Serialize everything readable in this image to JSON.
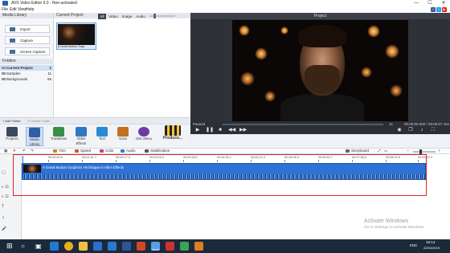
{
  "window": {
    "title": "AVS Video Editor 9.0 - Non-activated",
    "minimize": "—",
    "maximize": "☐",
    "close": "✕"
  },
  "menu": [
    "File",
    "Edit",
    "View",
    "Help"
  ],
  "social": [
    {
      "name": "facebook-icon",
      "color": "#3b5998",
      "glyph": "f"
    },
    {
      "name": "twitter-icon",
      "color": "#1da1f2",
      "glyph": "t"
    },
    {
      "name": "youtube-icon",
      "color": "#e62117",
      "glyph": "▶"
    }
  ],
  "media_library": {
    "header": "Media Library",
    "buttons": [
      {
        "label": "Import",
        "icon": "import-icon"
      },
      {
        "label": "Capture",
        "icon": "capture-icon"
      },
      {
        "label": "Screen Capture",
        "icon": "screen-capture-icon"
      }
    ],
    "folders_header": "Folders",
    "folders": [
      {
        "label": "Current Project",
        "count": "1"
      },
      {
        "label": "Samples",
        "count": "11"
      },
      {
        "label": "Backgrounds",
        "count": "65"
      }
    ],
    "add_folder": "+ Add Folder",
    "delete_folder": "✕ Delete Folder"
  },
  "current_project": {
    "header": "Current Project",
    "filters": [
      "All",
      "Video",
      "Image",
      "Audio"
    ],
    "item_caption": "A Great Motion Grap..."
  },
  "project_panel": {
    "header": "Project",
    "status": "Paused",
    "zoom": "1x",
    "time": "00:00:00.000 / 00:05:07.151"
  },
  "toolbar": [
    {
      "label": "Projects",
      "icon": "projects-icon",
      "color": "#3a4a5e"
    },
    {
      "label": "Media Library",
      "icon": "media-library-icon",
      "color": "#2d5fa6"
    },
    {
      "label": "Transitions",
      "icon": "transitions-icon",
      "color": "#3c8d4a"
    },
    {
      "label": "Video Effects",
      "icon": "video-effects-icon",
      "color": "#2f78c4"
    },
    {
      "label": "Text",
      "icon": "text-icon",
      "color": "#2a8ad6"
    },
    {
      "label": "Voice",
      "icon": "voice-icon",
      "color": "#c2701f"
    },
    {
      "label": "Disc Menu",
      "icon": "disc-menu-icon",
      "color": "#6d3aa6"
    }
  ],
  "produce_label": "Produce...",
  "edit_toolbar": [
    {
      "label": "Trim",
      "icon": "trim-icon",
      "color": "#c78a2a"
    },
    {
      "label": "Speed",
      "icon": "speed-icon",
      "color": "#d05a2a"
    },
    {
      "label": "Color",
      "icon": "color-icon",
      "color": "#c93c8a"
    },
    {
      "label": "Audio",
      "icon": "audio-icon",
      "color": "#3b7bd0"
    },
    {
      "label": "Stabilization",
      "icon": "stabilization-icon",
      "color": "#555555"
    }
  ],
  "storyboard_label": "Storyboard",
  "timeline": {
    "ticks": [
      "00:00:45.6",
      "00:01:31.7",
      "00:02:17.3",
      "00:03:03.4",
      "00:03:48.2",
      "00:04:35.1",
      "00:05:21.0",
      "00:06:06.9",
      "00:06:52.7",
      "00:07:38.6",
      "00:08:24.5",
      "00:09:10.3"
    ],
    "clip_title": "A Great Motion Graphics Technique in After Effects"
  },
  "watermark": {
    "line1": "Activate Windows",
    "line2": "Go to Settings to activate Windows."
  },
  "taskbar": {
    "apps": [
      {
        "name": "windows-start-icon",
        "color": "#ffffff"
      },
      {
        "name": "search-icon",
        "color": "#ffffff"
      },
      {
        "name": "task-view-icon",
        "color": "#ffffff"
      },
      {
        "name": "edge-icon",
        "color": "#1e7bd4"
      },
      {
        "name": "chrome-icon",
        "color": "#e8b01d"
      },
      {
        "name": "explorer-icon",
        "color": "#f0c040"
      },
      {
        "name": "store-icon",
        "color": "#2d6fd0"
      },
      {
        "name": "mail-icon",
        "color": "#2a78d4"
      },
      {
        "name": "word-icon",
        "color": "#2b5797"
      },
      {
        "name": "powerpoint-icon",
        "color": "#d24726"
      },
      {
        "name": "avs-icon",
        "color": "#5aa0e0"
      },
      {
        "name": "app-icon",
        "color": "#cc3333"
      },
      {
        "name": "app2-icon",
        "color": "#3aa35a"
      },
      {
        "name": "app3-icon",
        "color": "#e07c24"
      }
    ],
    "lang": "ENG",
    "time": "15:14",
    "date": "22/04/2019"
  }
}
